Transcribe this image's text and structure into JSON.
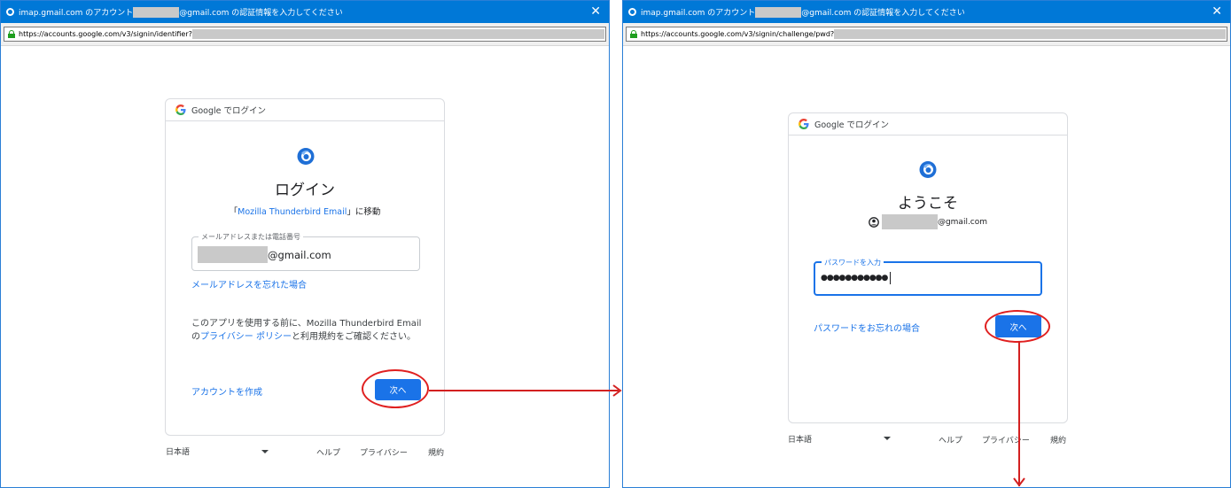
{
  "window1": {
    "title_prefix": "imap.gmail.com のアカウント",
    "title_suffix": "@gmail.com の認証情報を入力してください",
    "close_label": "✕",
    "url": "https://accounts.google.com/v3/signin/identifier?",
    "card_header": "Google でログイン",
    "heading": "ログイン",
    "subtitle_open": "「",
    "subtitle_app": "Mozilla Thunderbird Email",
    "subtitle_close": "」に移動",
    "email_label": "メールアドレスまたは電話番号",
    "email_suffix": "@gmail.com",
    "forgot_email": "メールアドレスを忘れた場合",
    "notice_before": "このアプリを使用する前に、Mozilla Thunderbird Email の",
    "notice_link": "プライバシー ポリシー",
    "notice_after": "と利用規約をご確認ください。",
    "create_account": "アカウントを作成",
    "next": "次へ",
    "language": "日本語",
    "help": "ヘルプ",
    "privacy": "プライバシー",
    "terms": "規約"
  },
  "window2": {
    "title_prefix": "imap.gmail.com のアカウント",
    "title_suffix": "@gmail.com の認証情報を入力してください",
    "close_label": "✕",
    "url": "https://accounts.google.com/v3/signin/challenge/pwd?",
    "card_header": "Google でログイン",
    "heading": "ようこそ",
    "account_suffix": "@gmail.com",
    "password_label": "パスワードを入力",
    "password_value": "●●●●●●●●●●●",
    "forgot_password": "パスワードをお忘れの場合",
    "next": "次へ",
    "language": "日本語",
    "help": "ヘルプ",
    "privacy": "プライバシー",
    "terms": "規約"
  },
  "colors": {
    "titlebar": "#0078d7",
    "google_blue": "#1a73e8",
    "annotation_red": "#e02020"
  }
}
